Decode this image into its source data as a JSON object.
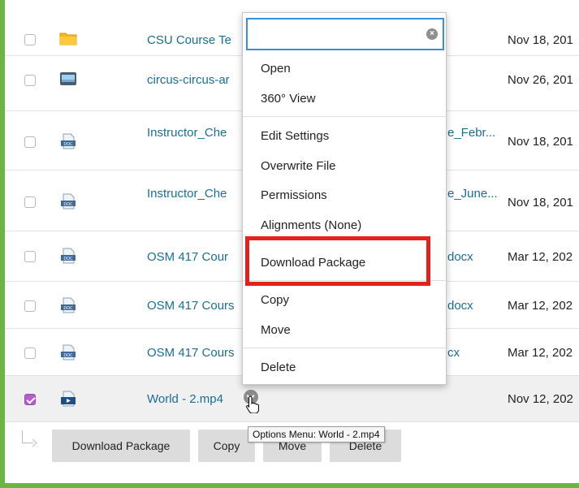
{
  "files": [
    {
      "name": "CSU Course Te",
      "name_right": "",
      "date": "Nov 18, 201",
      "icon": "folder-icon",
      "checked": false
    },
    {
      "name": "circus-circus-ar",
      "name_right": "",
      "date": "Nov 26, 201",
      "icon": "image-file-icon",
      "checked": false
    },
    {
      "name": "Instructor_Che",
      "name_right": "e_Febr...",
      "date": "Nov 18, 201",
      "icon": "doc-file-icon",
      "checked": false
    },
    {
      "name": "Instructor_Che",
      "name_right": "e_June...",
      "date": "Nov 18, 201",
      "icon": "doc-file-icon",
      "checked": false
    },
    {
      "name": "OSM 417 Cour",
      "name_right": "docx",
      "date": "Mar 12, 202",
      "icon": "doc-file-icon",
      "checked": false
    },
    {
      "name": "OSM 417 Cours",
      "name_right": "docx",
      "date": "Mar 12, 202",
      "icon": "doc-file-icon",
      "checked": false
    },
    {
      "name": "OSM 417 Cours",
      "name_right": "cx",
      "date": "Mar 12, 202",
      "icon": "doc-file-icon",
      "checked": false
    },
    {
      "name": "World - 2.mp4",
      "name_right": "",
      "date": "Nov 12, 202",
      "icon": "video-file-icon",
      "checked": true
    }
  ],
  "options_menu": {
    "search_value": "",
    "items": {
      "open": "Open",
      "view_360": "360° View",
      "edit_settings": "Edit Settings",
      "overwrite_file": "Overwrite File",
      "permissions": "Permissions",
      "alignments": "Alignments (None)",
      "download_package": "Download Package",
      "copy": "Copy",
      "move": "Move",
      "delete": "Delete"
    },
    "highlighted_item": "Download Package",
    "highlight_color": "#e3221b"
  },
  "tooltip": "Options Menu: World - 2.mp4",
  "actions": {
    "download_package": "Download Package",
    "copy": "Copy",
    "move": "Move",
    "delete": "Delete"
  },
  "colors": {
    "frame": "#6bb544",
    "link": "#1c6d94",
    "checkbox_checked": "#b35fc9",
    "focus": "#3a8fd8"
  }
}
